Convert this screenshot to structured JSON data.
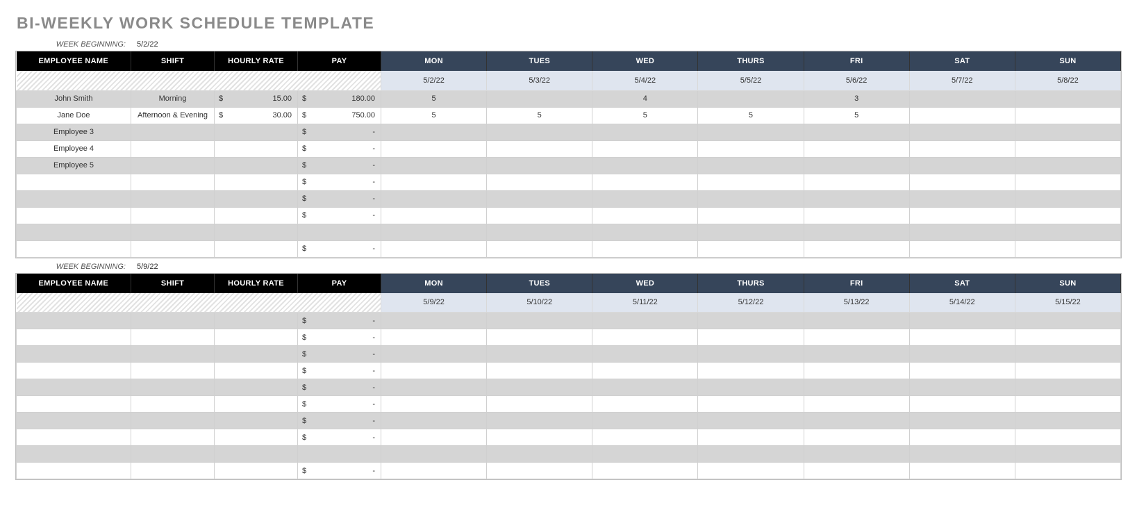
{
  "title": "BI-WEEKLY WORK SCHEDULE TEMPLATE",
  "labels": {
    "week_beginning": "WEEK BEGINNING:",
    "employee_name": "EMPLOYEE NAME",
    "shift": "SHIFT",
    "hourly_rate": "HOURLY RATE",
    "pay": "PAY",
    "days": [
      "MON",
      "TUES",
      "WED",
      "THURS",
      "FRI",
      "SAT",
      "SUN"
    ]
  },
  "currency": "$",
  "dash": "-",
  "weeks": [
    {
      "start": "5/2/22",
      "dates": [
        "5/2/22",
        "5/3/22",
        "5/4/22",
        "5/5/22",
        "5/6/22",
        "5/7/22",
        "5/8/22"
      ],
      "rows": [
        {
          "name": "John Smith",
          "shift": "Morning",
          "rate": "15.00",
          "pay": "180.00",
          "days": [
            "5",
            "",
            "4",
            "",
            "3",
            "",
            ""
          ]
        },
        {
          "name": "Jane Doe",
          "shift": "Afternoon & Evening",
          "rate": "30.00",
          "pay": "750.00",
          "days": [
            "5",
            "5",
            "5",
            "5",
            "5",
            "",
            ""
          ]
        },
        {
          "name": "Employee 3",
          "shift": "",
          "rate": "",
          "pay": "-",
          "days": [
            "",
            "",
            "",
            "",
            "",
            "",
            ""
          ]
        },
        {
          "name": "Employee 4",
          "shift": "",
          "rate": "",
          "pay": "-",
          "days": [
            "",
            "",
            "",
            "",
            "",
            "",
            ""
          ]
        },
        {
          "name": "Employee 5",
          "shift": "",
          "rate": "",
          "pay": "-",
          "days": [
            "",
            "",
            "",
            "",
            "",
            "",
            ""
          ]
        },
        {
          "name": "",
          "shift": "",
          "rate": "",
          "pay": "-",
          "days": [
            "",
            "",
            "",
            "",
            "",
            "",
            ""
          ]
        },
        {
          "name": "",
          "shift": "",
          "rate": "",
          "pay": "-",
          "days": [
            "",
            "",
            "",
            "",
            "",
            "",
            ""
          ]
        },
        {
          "name": "",
          "shift": "",
          "rate": "",
          "pay": "-",
          "days": [
            "",
            "",
            "",
            "",
            "",
            "",
            ""
          ]
        },
        {
          "name": "",
          "shift": "",
          "rate": "",
          "pay": "",
          "days": [
            "",
            "",
            "",
            "",
            "",
            "",
            ""
          ]
        },
        {
          "name": "",
          "shift": "",
          "rate": "",
          "pay": "-",
          "days": [
            "",
            "",
            "",
            "",
            "",
            "",
            ""
          ]
        }
      ]
    },
    {
      "start": "5/9/22",
      "dates": [
        "5/9/22",
        "5/10/22",
        "5/11/22",
        "5/12/22",
        "5/13/22",
        "5/14/22",
        "5/15/22"
      ],
      "rows": [
        {
          "name": "",
          "shift": "",
          "rate": "",
          "pay": "-",
          "days": [
            "",
            "",
            "",
            "",
            "",
            "",
            ""
          ]
        },
        {
          "name": "",
          "shift": "",
          "rate": "",
          "pay": "-",
          "days": [
            "",
            "",
            "",
            "",
            "",
            "",
            ""
          ]
        },
        {
          "name": "",
          "shift": "",
          "rate": "",
          "pay": "-",
          "days": [
            "",
            "",
            "",
            "",
            "",
            "",
            ""
          ]
        },
        {
          "name": "",
          "shift": "",
          "rate": "",
          "pay": "-",
          "days": [
            "",
            "",
            "",
            "",
            "",
            "",
            ""
          ]
        },
        {
          "name": "",
          "shift": "",
          "rate": "",
          "pay": "-",
          "days": [
            "",
            "",
            "",
            "",
            "",
            "",
            ""
          ]
        },
        {
          "name": "",
          "shift": "",
          "rate": "",
          "pay": "-",
          "days": [
            "",
            "",
            "",
            "",
            "",
            "",
            ""
          ]
        },
        {
          "name": "",
          "shift": "",
          "rate": "",
          "pay": "-",
          "days": [
            "",
            "",
            "",
            "",
            "",
            "",
            ""
          ]
        },
        {
          "name": "",
          "shift": "",
          "rate": "",
          "pay": "-",
          "days": [
            "",
            "",
            "",
            "",
            "",
            "",
            ""
          ]
        },
        {
          "name": "",
          "shift": "",
          "rate": "",
          "pay": "",
          "days": [
            "",
            "",
            "",
            "",
            "",
            "",
            ""
          ]
        },
        {
          "name": "",
          "shift": "",
          "rate": "",
          "pay": "-",
          "days": [
            "",
            "",
            "",
            "",
            "",
            "",
            ""
          ]
        }
      ]
    }
  ]
}
